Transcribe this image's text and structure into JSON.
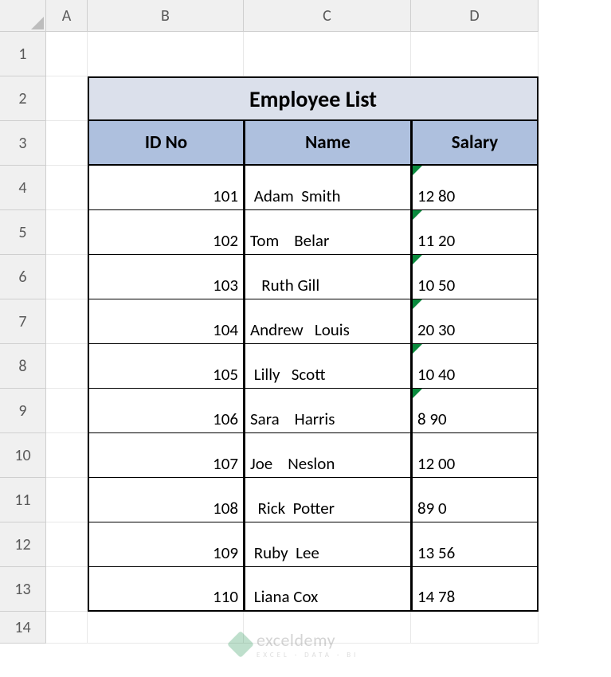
{
  "columns": [
    "A",
    "B",
    "C",
    "D"
  ],
  "rows": [
    "1",
    "2",
    "3",
    "4",
    "5",
    "6",
    "7",
    "8",
    "9",
    "10",
    "11",
    "12",
    "13",
    "14"
  ],
  "sheet": {
    "title": "Employee List",
    "headers": {
      "id": "ID No",
      "name": "Name",
      "salary": "Salary"
    },
    "data": [
      {
        "id": "101",
        "name": " Adam  Smith",
        "salary": "12 80"
      },
      {
        "id": "102",
        "name": "Tom    Belar",
        "salary": "11 20"
      },
      {
        "id": "103",
        "name": "   Ruth Gill",
        "salary": "10 50"
      },
      {
        "id": "104",
        "name": "Andrew   Louis",
        "salary": "20 30"
      },
      {
        "id": "105",
        "name": " Lilly   Scott",
        "salary": "10 40"
      },
      {
        "id": "106",
        "name": "Sara    Harris",
        "salary": "8 90"
      },
      {
        "id": "107",
        "name": "Joe    Neslon",
        "salary": "12 00"
      },
      {
        "id": "108",
        "name": "  Rick  Potter",
        "salary": "89 0"
      },
      {
        "id": "109",
        "name": " Ruby  Lee",
        "salary": "13 56"
      },
      {
        "id": "110",
        "name": " Liana Cox",
        "salary": "14 78"
      }
    ],
    "error_flag_rows": [
      0,
      1,
      2,
      3,
      4,
      5
    ]
  },
  "watermark": {
    "brand": "exceldemy",
    "sub": "EXCEL · DATA · BI"
  }
}
